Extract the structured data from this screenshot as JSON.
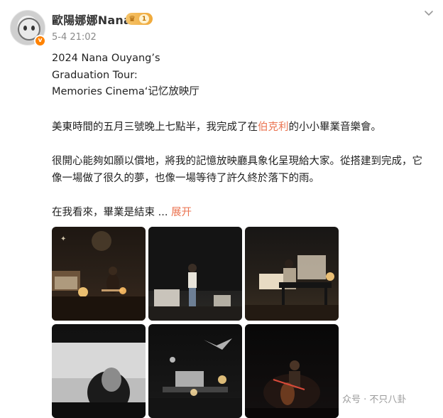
{
  "author": {
    "name": "歐陽娜娜Nana",
    "level": "1",
    "verified_mark": "v",
    "avatar_icon": "cartoon-avatar-icon"
  },
  "post": {
    "time": "5-4 21:02",
    "title_lines": [
      "2024 Nana Ouyang’s",
      "Graduation Tour:",
      "Memories Cinema‘记忆放映厅"
    ],
    "p1_before": "美東時間的五月三號晚上七點半，我完成了在",
    "p1_link": "伯克利",
    "p1_after": "的小小畢業音樂會。",
    "p2": "很開心能夠如願以償地，將我的記憶放映廳具象化呈現給大家。從搭建到完成，它",
    "p3": "像一場做了很久的夢，也像一場等待了許久終於落下的雨。",
    "p4": "在我看來，畢業是結束 ",
    "ellipsis": "...",
    "expand_label": "展开"
  },
  "photos": [
    {
      "alt": "stage-photo-guitar-corner"
    },
    {
      "alt": "stage-photo-singer-center"
    },
    {
      "alt": "stage-photo-piano"
    },
    {
      "alt": "screen-portrait-bw"
    },
    {
      "alt": "stage-overview-bw"
    },
    {
      "alt": "cello-performance"
    }
  ],
  "watermark": "众号 · 不只八卦"
}
